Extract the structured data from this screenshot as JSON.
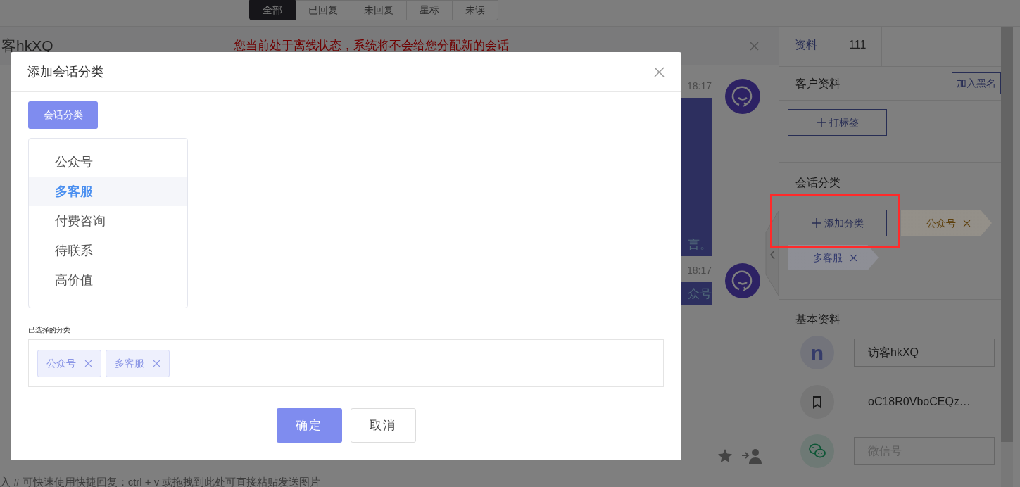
{
  "filter_tabs": [
    {
      "label": "全部",
      "selected": true
    },
    {
      "label": "已回复",
      "selected": false
    },
    {
      "label": "未回复",
      "selected": false
    },
    {
      "label": "星标",
      "selected": false
    },
    {
      "label": "未读",
      "selected": false
    }
  ],
  "conversation": {
    "title": "客hkXQ",
    "notice": "您当前处于离线状态，系统将不会给您分配新的会话",
    "messages": [
      {
        "time": "18:17",
        "text": "言。",
        "tall": true
      },
      {
        "time": "18:17",
        "text": "众号",
        "tall": false
      }
    ],
    "input_hint": "入 # 可快速使用快捷回复：ctrl + v 或拖拽到此处可直接粘贴发送图片"
  },
  "side_panel": {
    "tabs": [
      {
        "label": "资料",
        "selected": true
      },
      {
        "label": "111",
        "selected": false
      }
    ],
    "customer": {
      "title": "客户资料",
      "blacklist_button": "加入黑名",
      "tag_button": "打标签"
    },
    "categories": {
      "title": "会话分类",
      "add_button": "添加分类",
      "tags": [
        {
          "label": "公众号",
          "color": "#5e400c"
        },
        {
          "label": "多客服",
          "color": "#323a6e"
        }
      ]
    },
    "basic": {
      "title": "基本资料",
      "avatar_letter": "n",
      "name_value": "访客hkXQ",
      "openid": "oC18R0VboCEQz…",
      "wechat_placeholder": "微信号"
    }
  },
  "dialog": {
    "title": "添加会话分类",
    "tab": "会话分类",
    "options": [
      {
        "label": "公众号",
        "selected": false
      },
      {
        "label": "多客服",
        "selected": true
      },
      {
        "label": "付费咨询",
        "selected": false
      },
      {
        "label": "待联系",
        "selected": false
      },
      {
        "label": "高价值",
        "selected": false
      }
    ],
    "selected_label": "已选择的分类",
    "selected_tags": [
      "公众号",
      "多客服"
    ],
    "buttons": [
      {
        "label": "确定",
        "kind": "primary"
      },
      {
        "label": "取消",
        "kind": "secondary"
      }
    ]
  }
}
